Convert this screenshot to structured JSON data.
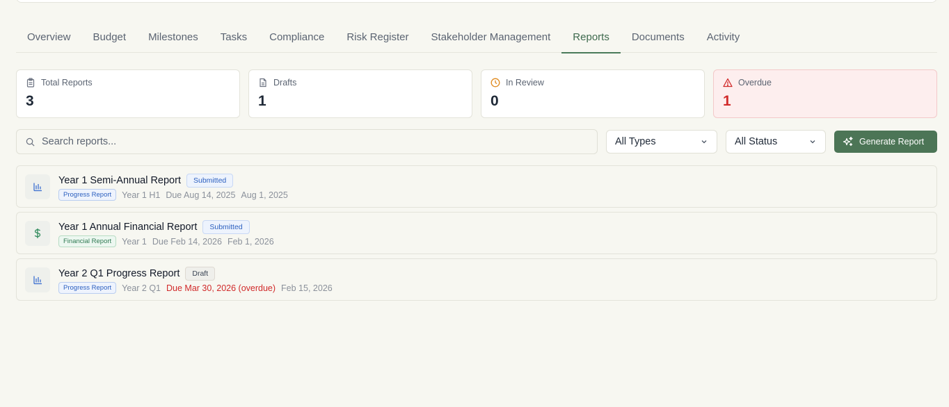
{
  "tabs": [
    {
      "label": "Overview"
    },
    {
      "label": "Budget"
    },
    {
      "label": "Milestones"
    },
    {
      "label": "Tasks"
    },
    {
      "label": "Compliance"
    },
    {
      "label": "Risk Register"
    },
    {
      "label": "Stakeholder Management"
    },
    {
      "label": "Reports"
    },
    {
      "label": "Documents"
    },
    {
      "label": "Activity"
    }
  ],
  "active_tab": "Reports",
  "stats": [
    {
      "label": "Total Reports",
      "value": "3",
      "icon": "clipboard-icon"
    },
    {
      "label": "Drafts",
      "value": "1",
      "icon": "document-icon"
    },
    {
      "label": "In Review",
      "value": "0",
      "icon": "clock-icon"
    },
    {
      "label": "Overdue",
      "value": "1",
      "icon": "warning-icon"
    }
  ],
  "search": {
    "placeholder": "Search reports..."
  },
  "filters": {
    "type": "All Types",
    "status": "All Status"
  },
  "generate_button": "Generate Report",
  "reports": [
    {
      "title": "Year 1 Semi-Annual Report",
      "status": "Submitted",
      "type": "Progress Report",
      "period": "Year 1 H1",
      "due": "Due Aug 14, 2025",
      "date": "Aug 1, 2025",
      "icon": "bar-chart-icon"
    },
    {
      "title": "Year 1 Annual Financial Report",
      "status": "Submitted",
      "type": "Financial Report",
      "period": "Year 1",
      "due": "Due Feb 14, 2026",
      "date": "Feb 1, 2026",
      "icon": "dollar-icon"
    },
    {
      "title": "Year 2 Q1 Progress Report",
      "status": "Draft",
      "type": "Progress Report",
      "period": "Year 2 Q1",
      "due": "Due Mar 30, 2026 (overdue)",
      "date": "Feb 15, 2026",
      "icon": "bar-chart-icon"
    }
  ],
  "colors": {
    "accent": "#4c7556",
    "danger": "#d12a2a",
    "info": "#2b5fbf",
    "success": "#2f7a52"
  }
}
